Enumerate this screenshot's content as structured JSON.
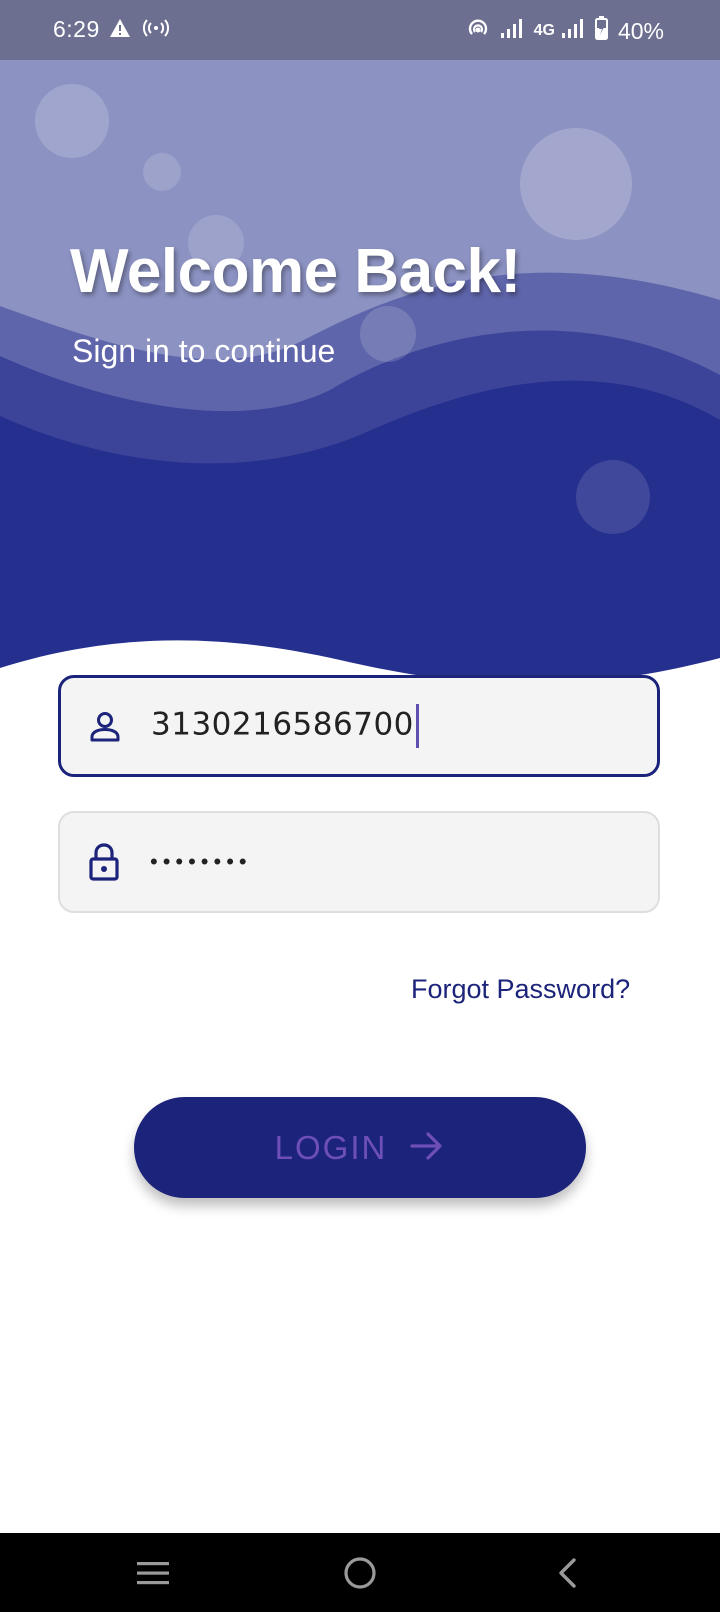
{
  "status_bar": {
    "time": "6:29",
    "network_type": "4G",
    "battery_percent": "40%",
    "icons": [
      "warning-icon",
      "wireless-broadcast-icon",
      "hotspot-icon",
      "signal-icon",
      "signal-icon",
      "battery-charging-icon"
    ]
  },
  "header": {
    "title": "Welcome Back!",
    "subtitle": "Sign in to continue"
  },
  "form": {
    "username": {
      "value": "3130216586700",
      "icon": "person-icon"
    },
    "password": {
      "masked_value": "••••••••",
      "icon": "lock-icon"
    },
    "forgot_password_label": "Forgot Password?",
    "login_label": "LOGIN",
    "login_icon": "arrow-right-icon"
  },
  "nav_bar": {
    "icons": [
      "menu-icon",
      "home-icon",
      "back-icon"
    ]
  },
  "colors": {
    "primary": "#1c237a",
    "header_light": "#8c92c2",
    "button_text": "#6e4fb8",
    "status_bar": "#6d6f91"
  }
}
